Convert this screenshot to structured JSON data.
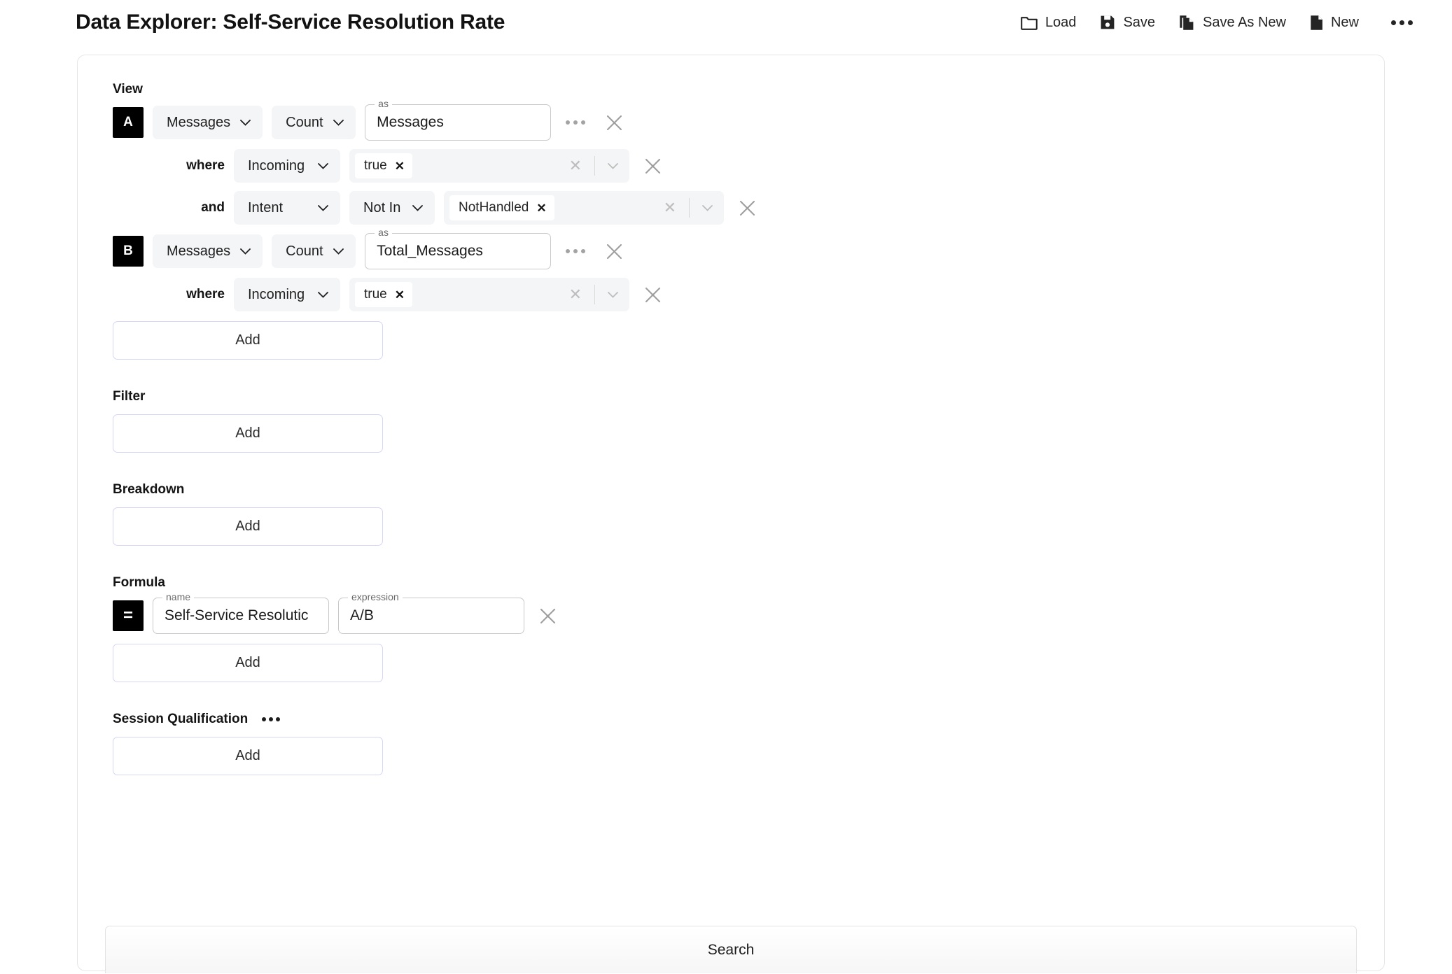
{
  "header": {
    "title": "Data Explorer: Self-Service Resolution Rate",
    "toolbar": [
      {
        "label": "Load",
        "icon": "folder-icon"
      },
      {
        "label": "Save",
        "icon": "floppy-disk-icon"
      },
      {
        "label": "Save As New",
        "icon": "copy-document-icon"
      },
      {
        "label": "New",
        "icon": "document-icon"
      }
    ],
    "overflow_icon": "ellipsis-icon"
  },
  "sections": {
    "view": {
      "label": "View",
      "add_label": "Add",
      "rows": [
        {
          "badge": "A",
          "source": "Messages",
          "aggregate": "Count",
          "as_legend": "as",
          "as_value": "Messages"
        },
        {
          "conjunction": "where",
          "field": "Incoming",
          "tokens": [
            "true"
          ]
        },
        {
          "conjunction": "and",
          "field": "Intent",
          "operator": "Not In",
          "tokens": [
            "NotHandled"
          ]
        },
        {
          "badge": "B",
          "source": "Messages",
          "aggregate": "Count",
          "as_legend": "as",
          "as_value": "Total_Messages"
        },
        {
          "conjunction": "where",
          "field": "Incoming",
          "tokens": [
            "true"
          ]
        }
      ]
    },
    "filter": {
      "label": "Filter",
      "add_label": "Add"
    },
    "breakdown": {
      "label": "Breakdown",
      "add_label": "Add"
    },
    "formula": {
      "label": "Formula",
      "add_label": "Add",
      "badge": "=",
      "name_legend": "name",
      "name_value": "Self-Service Resolutic",
      "expression_legend": "expression",
      "expression_value": "A/B"
    },
    "session_qualification": {
      "label": "Session Qualification",
      "add_label": "Add",
      "overflow_icon": "ellipsis-icon"
    }
  },
  "footer": {
    "search_label": "Search"
  },
  "colors": {
    "accent_border": "#d6d6f5",
    "badge_bg": "#000000",
    "control_bg": "#f4f5f7",
    "card_border": "#e6e6e6"
  }
}
